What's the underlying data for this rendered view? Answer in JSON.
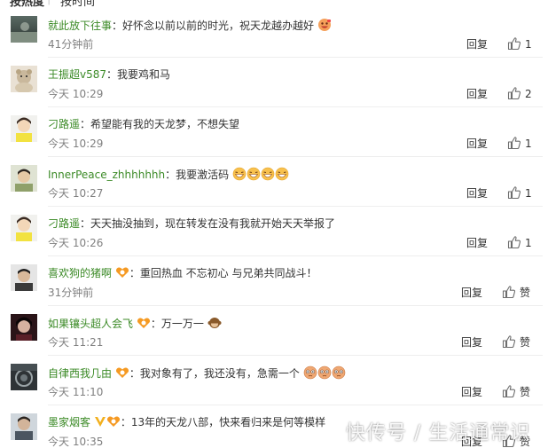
{
  "tabs": {
    "hot": "按热度",
    "time": "按时间"
  },
  "actions": {
    "reply": "回复"
  },
  "watermark": "快传号 / 生活通常识",
  "comments": [
    {
      "user": "就此放下往事",
      "text": "：好怀念以前以前的时光，祝天龙越办越好",
      "time": "41分钟前",
      "likes": "1",
      "emojis": [
        "grin-face"
      ]
    },
    {
      "user": "王振超v587",
      "text": "：我要鸡和马",
      "time": "今天 10:29",
      "likes": "2",
      "emojis": []
    },
    {
      "user": "刁路遥",
      "text": "：希望能有我的天龙梦，不想失望",
      "time": "今天 10:29",
      "likes": "1",
      "emojis": []
    },
    {
      "user": "InnerPeace_zhhhhhhh",
      "text": "：我要激活码",
      "time": "今天 10:27",
      "likes": "1",
      "emojis": [
        "laugh-face",
        "laugh-face",
        "laugh-face",
        "laugh-face"
      ]
    },
    {
      "user": "刁路遥",
      "text": "：天天抽没抽到，现在转发在没有我就开始天天举报了",
      "time": "今天 10:26",
      "likes": "1",
      "emojis": []
    },
    {
      "user": "喜欢狗的猪啊",
      "text": "：重回热血 不忘初心 与兄弟共同战斗！",
      "time": "31分钟前",
      "likes": "赞",
      "emojis": [],
      "badges": [
        "fan-badge"
      ]
    },
    {
      "user": "如果镶头超人会飞",
      "text": "：万一万一",
      "time": "今天 11:21",
      "likes": "赞",
      "emojis": [
        "monkey-face"
      ],
      "badges": [
        "fan-badge"
      ]
    },
    {
      "user": "自律西我几由",
      "text": "：我对象有了，我还没有，急需一个",
      "time": "今天 11:10",
      "likes": "赞",
      "emojis": [
        "cry-face",
        "cry-face",
        "cry-face"
      ],
      "badges": [
        "fan-badge"
      ]
    },
    {
      "user": "墨家烟客",
      "text": "：13年的天龙八部，快来看归来是何等模样",
      "time": "今天 10:35",
      "likes": "赞",
      "emojis": [],
      "badges": [
        "vip-badge",
        "fan-badge"
      ]
    }
  ]
}
